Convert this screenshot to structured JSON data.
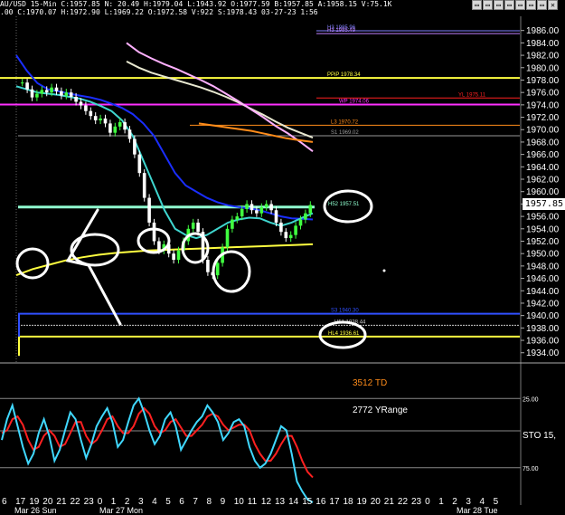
{
  "header": {
    "symbol": "AU/USD",
    "interval": "15-Min",
    "line1": "AU/USD 15-Min C:1957.85 N: 20.49 H:1979.04 L:1943.92 O:1977.59 B:1957.85 A:1958.15 V:75.1K",
    "line2": ".00 C:1970.07 H:1972.90 L:1969.22 O:1972.58 V:922 S:1978.43 03-27-23 1:56"
  },
  "price_axis": {
    "labels": [
      "1986.00",
      "1984.00",
      "1982.00",
      "1980.00",
      "1978.00",
      "1976.00",
      "1974.00",
      "1972.00",
      "1970.00",
      "1968.00",
      "1966.00",
      "1964.00",
      "1962.00",
      "1960.00",
      "1958.00",
      "1956.00",
      "1954.00",
      "1952.00",
      "1950.00",
      "1948.00",
      "1946.00",
      "1944.00",
      "1942.00",
      "1940.00",
      "1938.00",
      "1936.00",
      "1934.00"
    ],
    "last_price": "1957.85"
  },
  "level_labels": [
    {
      "text": "H3 1985.96"
    },
    {
      "text": "H3 1985.49"
    },
    {
      "text": "PPiP 1978.34"
    },
    {
      "text": "YL 1975.11"
    },
    {
      "text": "WP 1974.06"
    },
    {
      "text": "L3 1970.72"
    },
    {
      "text": "S1 1969.02"
    },
    {
      "text": "H52 1957.51"
    },
    {
      "text": "S3 1940.30"
    },
    {
      "text": "H51 1938.44"
    },
    {
      "text": "HL4 1936.61"
    }
  ],
  "annotations": {
    "td": "3512 TD",
    "yrange": "2772 YRange"
  },
  "oscillator": {
    "name": "STO  15,",
    "labels": [
      "25.00",
      "75.00"
    ]
  },
  "time_axis": {
    "labels": [
      "6",
      "17",
      "19",
      "20",
      "21",
      "22",
      "23",
      "0",
      "1",
      "2",
      "3",
      "4",
      "5",
      "6",
      "7",
      "8",
      "9",
      "10",
      "11",
      "12",
      "13",
      "14",
      "15",
      "16",
      "17",
      "18",
      "19",
      "20",
      "21",
      "22",
      "23",
      "0",
      "1",
      "2",
      "3",
      "4",
      "5"
    ],
    "dates": [
      "Mar 26 Sun",
      "Mar 27 Mon",
      "Mar 28 Tue"
    ]
  },
  "colors": {
    "background": "#000000",
    "candle_up": "#40ff40",
    "candle_down": "#ffffff",
    "ema_blue": "#1a2eff",
    "ema_cyan": "#3fd6cf",
    "ma_white": "#e8e8d0",
    "ma_pink": "#ffb0ff",
    "ma_orange": "#ff8c1a",
    "yellow": "#ffff40",
    "magenta": "#ff30ff",
    "red": "#ff2020",
    "sto_k": "#40d8ff",
    "sto_d": "#ff2020",
    "td_orange": "#ff8c1a"
  },
  "chart_data": {
    "type": "line",
    "title": "AU/USD 15-Min",
    "xlabel": "",
    "ylabel": "",
    "ylim": [
      1932.5,
      1988
    ],
    "x_tick_labels": [
      "6",
      "17",
      "19",
      "20",
      "21",
      "22",
      "23",
      "0",
      "1",
      "2",
      "3",
      "4",
      "5",
      "6",
      "7",
      "8",
      "9",
      "10",
      "11",
      "12",
      "13",
      "14",
      "15",
      "16",
      "17",
      "18",
      "19",
      "20",
      "21",
      "22",
      "23",
      "0",
      "1",
      "2",
      "3",
      "4",
      "5"
    ],
    "price_series": {
      "name": "",
      "values": [
        1977.6,
        1976.5,
        1975.2,
        1975.8,
        1976.4,
        1976.0,
        1976.8,
        1976.2,
        1975.5,
        1976.0,
        1975.3,
        1974.5,
        1973.9,
        1973.0,
        1972.2,
        1971.5,
        1971.8,
        1971.0,
        1969.5,
        1970.5,
        1971.2,
        1970.0,
        1968.5,
        1966.0,
        1963.0,
        1959.0,
        1955.0,
        1952.0,
        1950.5,
        1951.5,
        1950.0,
        1949.0,
        1950.5,
        1952.0,
        1954.0,
        1955.0,
        1953.5,
        1949.0,
        1947.0,
        1946.5,
        1948.5,
        1951.0,
        1954.0,
        1955.5,
        1956.0,
        1957.2,
        1958.0,
        1957.0,
        1956.5,
        1957.5,
        1958.0,
        1957.0,
        1955.0,
        1953.5,
        1952.5,
        1953.0,
        1954.5,
        1955.5,
        1956.5,
        1957.85
      ]
    },
    "moving_averages": [
      {
        "name": "",
        "values": [
          1982.0,
          1979.5,
          1977.5,
          1976.5,
          1976.2,
          1975.8,
          1975.5,
          1975.2,
          1974.8,
          1974.2,
          1973.5,
          1972.5,
          1971.0,
          1969.0,
          1966.0,
          1963.0,
          1961.0,
          1960.0,
          1959.0,
          1958.3,
          1957.8,
          1957.5,
          1957.3,
          1957.0,
          1956.5,
          1956.0,
          1955.7,
          1955.6,
          1955.5
        ]
      },
      {
        "name": "",
        "values": [
          1977.0,
          1976.5,
          1976.0,
          1975.8,
          1975.6,
          1975.3,
          1975.0,
          1974.5,
          1973.8,
          1973.0,
          1971.5,
          1969.0,
          1965.0,
          1961.0,
          1957.0,
          1954.0,
          1953.0,
          1952.5,
          1953.0,
          1954.0,
          1955.0,
          1955.5,
          1955.8,
          1955.7,
          1955.0,
          1954.5,
          1955.0,
          1955.8,
          1956.5
        ]
      },
      {
        "name": "",
        "values": [
          1981.0,
          1980.0,
          1979.2,
          1978.6,
          1978.0,
          1977.4,
          1976.8,
          1976.1,
          1975.3,
          1974.4,
          1973.4,
          1972.4,
          1971.3,
          1970.3,
          1969.5,
          1968.7
        ]
      },
      {
        "name": "",
        "values": [
          1984.0,
          1982.5,
          1981.5,
          1980.6,
          1979.8,
          1978.9,
          1978.0,
          1977.0,
          1975.8,
          1974.6,
          1973.3,
          1972.0,
          1970.6,
          1969.4,
          1968.0,
          1966.5
        ]
      },
      {
        "name": "",
        "values": [
          1971.0,
          1970.8,
          1970.6,
          1970.4,
          1970.2,
          1970.0,
          1969.8,
          1969.5,
          1969.2,
          1968.9,
          1968.6,
          1968.4,
          1968.2,
          1968.0
        ]
      },
      {
        "name": "",
        "values": [
          1946.5,
          1947.5,
          1948.2,
          1948.9,
          1949.4,
          1949.8,
          1950.1,
          1950.3,
          1950.5,
          1950.6,
          1950.7,
          1950.8,
          1950.9,
          1951.0,
          1951.1,
          1951.2,
          1951.3,
          1951.4,
          1951.5
        ]
      }
    ],
    "levels": [
      1985.96,
      1985.49,
      1978.34,
      1975.11,
      1974.06,
      1970.72,
      1969.02,
      1957.51,
      1940.3,
      1938.44,
      1936.61
    ],
    "oscillator": {
      "name": "STO 15",
      "ylim": [
        0,
        100
      ],
      "k": [
        55,
        40,
        30,
        45,
        60,
        72,
        65,
        50,
        40,
        52,
        70,
        62,
        48,
        35,
        40,
        55,
        68,
        58,
        45,
        38,
        32,
        42,
        60,
        55,
        42,
        30,
        25,
        35,
        48,
        58,
        52,
        40,
        35,
        45,
        62,
        55,
        48,
        42,
        38,
        30,
        35,
        42,
        55,
        50,
        42,
        40,
        45,
        60,
        70,
        75,
        72,
        65,
        55,
        45,
        48,
        65,
        85,
        92,
        98,
        100
      ],
      "d": [
        50,
        48,
        40,
        38,
        44,
        55,
        62,
        60,
        52,
        48,
        52,
        60,
        58,
        50,
        42,
        42,
        52,
        58,
        55,
        48,
        40,
        38,
        45,
        50,
        50,
        45,
        36,
        32,
        36,
        45,
        50,
        48,
        42,
        40,
        46,
        52,
        52,
        48,
        44,
        38,
        36,
        38,
        44,
        48,
        46,
        44,
        44,
        48,
        58,
        65,
        70,
        70,
        65,
        58,
        52,
        52,
        60,
        70,
        78,
        82
      ],
      "guides": [
        25,
        75
      ]
    }
  }
}
